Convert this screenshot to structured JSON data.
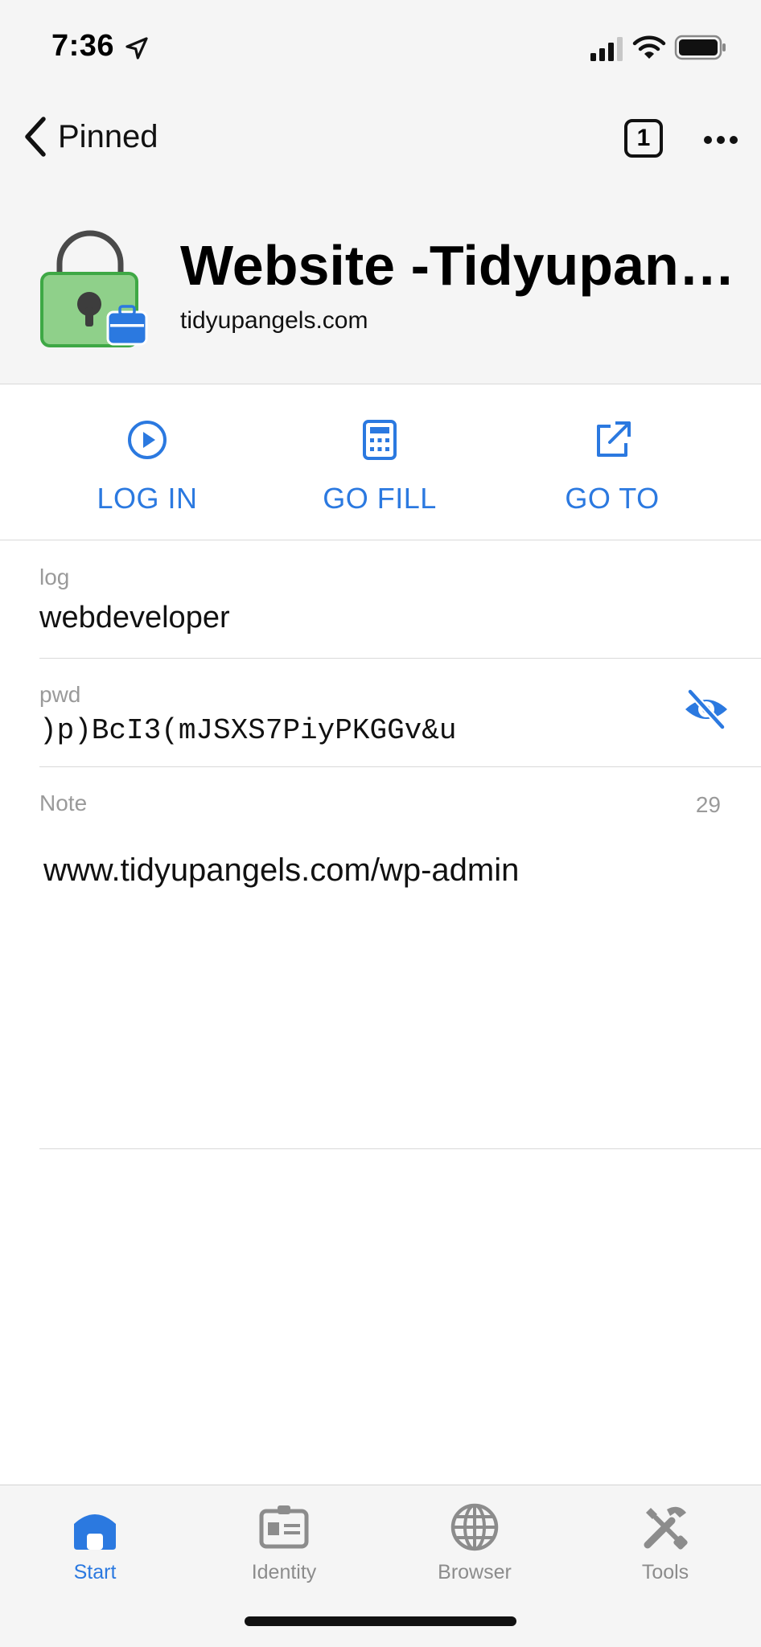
{
  "status_bar": {
    "time": "7:36"
  },
  "nav": {
    "back_label": "Pinned",
    "pin_count": "1"
  },
  "header": {
    "title": "Website -Tidyupan…",
    "domain": "tidyupangels.com"
  },
  "actions": [
    {
      "label": "LOG IN",
      "icon": "play-circle-icon"
    },
    {
      "label": "GO FILL",
      "icon": "calculator-icon"
    },
    {
      "label": "GO TO",
      "icon": "external-link-icon"
    }
  ],
  "fields": {
    "login": {
      "label": "log",
      "value": "webdeveloper"
    },
    "password": {
      "label": "pwd",
      "value": ")p)BcI3(mJSXS7PiyPKGGv&u"
    },
    "note": {
      "label": "Note",
      "count": "29",
      "value": "www.tidyupangels.com/wp-admin"
    }
  },
  "tabs": [
    {
      "label": "Start",
      "icon": "home-icon",
      "active": true
    },
    {
      "label": "Identity",
      "icon": "id-card-icon",
      "active": false
    },
    {
      "label": "Browser",
      "icon": "globe-icon",
      "active": false
    },
    {
      "label": "Tools",
      "icon": "tools-icon",
      "active": false
    }
  ],
  "colors": {
    "accent": "#2b79e0",
    "lock_green": "#8fd08a",
    "header_bg": "#f5f5f5"
  }
}
